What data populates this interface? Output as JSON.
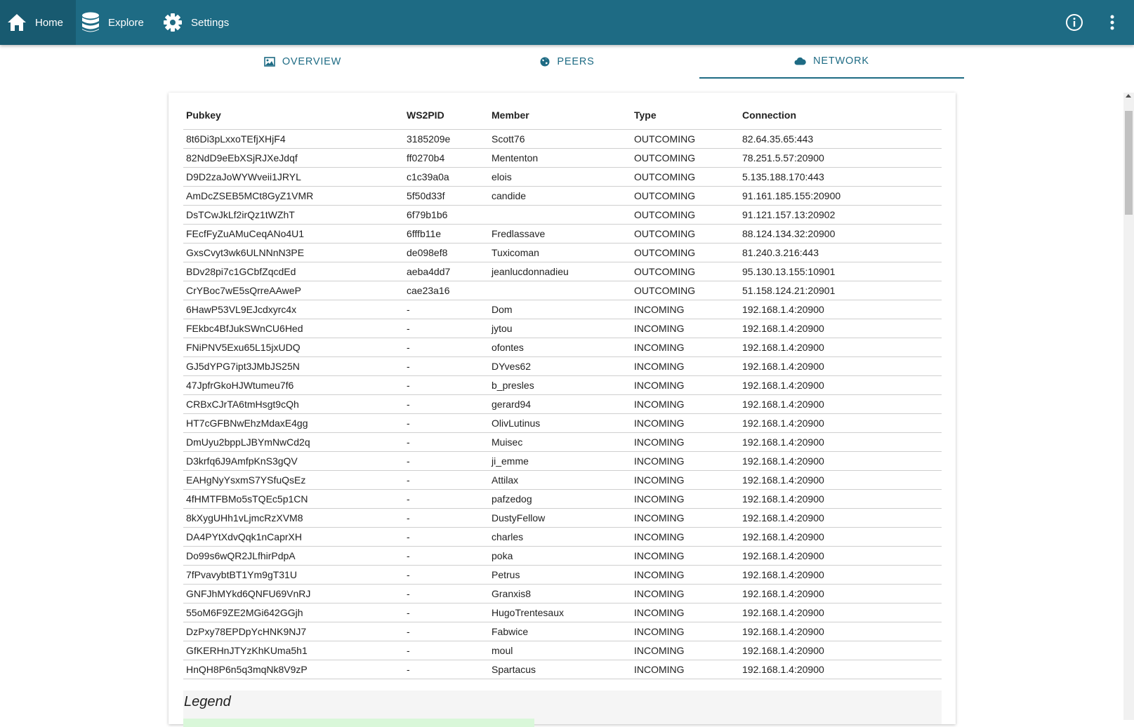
{
  "header": {
    "nav": [
      {
        "label": "Home",
        "icon": "home-icon"
      },
      {
        "label": "Explore",
        "icon": "database-icon"
      },
      {
        "label": "Settings",
        "icon": "gear-icon"
      }
    ],
    "right_icons": [
      "info-icon",
      "more-vert-icon"
    ],
    "color": "#1e6b84"
  },
  "tabs": [
    {
      "label": "OVERVIEW",
      "icon": "image-icon"
    },
    {
      "label": "PEERS",
      "icon": "globe-icon"
    },
    {
      "label": "NETWORK",
      "icon": "cloud-icon",
      "active": true
    }
  ],
  "table": {
    "columns": [
      "Pubkey",
      "WS2PID",
      "Member",
      "Type",
      "Connection"
    ],
    "rows": [
      [
        "8t6Di3pLxxoTEfjXHjF4",
        "3185209e",
        "Scott76",
        "OUTCOMING",
        "82.64.35.65:443"
      ],
      [
        "82NdD9eEbXSjRJXeJdqf",
        "ff0270b4",
        "Mententon",
        "OUTCOMING",
        "78.251.5.57:20900"
      ],
      [
        "D9D2zaJoWYWveii1JRYL",
        "c1c39a0a",
        "elois",
        "OUTCOMING",
        "5.135.188.170:443"
      ],
      [
        "AmDcZSEB5MCt8GyZ1VMR",
        "5f50d33f",
        "candide",
        "OUTCOMING",
        "91.161.185.155:20900"
      ],
      [
        "DsTCwJkLf2irQz1tWZhT",
        "6f79b1b6",
        "",
        "OUTCOMING",
        "91.121.157.13:20902"
      ],
      [
        "FEcfFyZuAMuCeqANo4U1",
        "6fffb11e",
        "Fredlassave",
        "OUTCOMING",
        "88.124.134.32:20900"
      ],
      [
        "GxsCvyt3wk6ULNNnN3PE",
        "de098ef8",
        "Tuxicoman",
        "OUTCOMING",
        "81.240.3.216:443"
      ],
      [
        "BDv28pi7c1GCbfZqcdEd",
        "aeba4dd7",
        "jeanlucdonnadieu",
        "OUTCOMING",
        "95.130.13.155:10901"
      ],
      [
        "CrYBoc7wE5sQrreAAweP",
        "cae23a16",
        "",
        "OUTCOMING",
        "51.158.124.21:20901"
      ],
      [
        "6HawP53VL9EJcdxyrc4x",
        "-",
        "Dom",
        "INCOMING",
        "192.168.1.4:20900"
      ],
      [
        "FEkbc4BfJukSWnCU6Hed",
        "-",
        "jytou",
        "INCOMING",
        "192.168.1.4:20900"
      ],
      [
        "FNiPNV5Exu65L15jxUDQ",
        "-",
        "ofontes",
        "INCOMING",
        "192.168.1.4:20900"
      ],
      [
        "GJ5dYPG7ipt3JMbJS25N",
        "-",
        "DYves62",
        "INCOMING",
        "192.168.1.4:20900"
      ],
      [
        "47JpfrGkoHJWtumeu7f6",
        "-",
        "b_presles",
        "INCOMING",
        "192.168.1.4:20900"
      ],
      [
        "CRBxCJrTA6tmHsgt9cQh",
        "-",
        "gerard94",
        "INCOMING",
        "192.168.1.4:20900"
      ],
      [
        "HT7cGFBNwEhzMdaxE4gg",
        "-",
        "OlivLutinus",
        "INCOMING",
        "192.168.1.4:20900"
      ],
      [
        "DmUyu2bppLJBYmNwCd2q",
        "-",
        "Muisec",
        "INCOMING",
        "192.168.1.4:20900"
      ],
      [
        "D3krfq6J9AmfpKnS3gQV",
        "-",
        "ji_emme",
        "INCOMING",
        "192.168.1.4:20900"
      ],
      [
        "EAHgNyYsxmS7YSfuQsEz",
        "-",
        "Attilax",
        "INCOMING",
        "192.168.1.4:20900"
      ],
      [
        "4fHMTFBMo5sTQEc5p1CN",
        "-",
        "pafzedog",
        "INCOMING",
        "192.168.1.4:20900"
      ],
      [
        "8kXygUHh1vLjmcRzXVM8",
        "-",
        "DustyFellow",
        "INCOMING",
        "192.168.1.4:20900"
      ],
      [
        "DA4PYtXdvQqk1nCaprXH",
        "-",
        "charles",
        "INCOMING",
        "192.168.1.4:20900"
      ],
      [
        "Do99s6wQR2JLfhirPdpA",
        "-",
        "poka",
        "INCOMING",
        "192.168.1.4:20900"
      ],
      [
        "7fPvavybtBT1Ym9gT31U",
        "-",
        "Petrus",
        "INCOMING",
        "192.168.1.4:20900"
      ],
      [
        "GNFJhMYkd6QNFU69VnRJ",
        "-",
        "Granxis8",
        "INCOMING",
        "192.168.1.4:20900"
      ],
      [
        "55oM6F9ZE2MGi642GGjh",
        "-",
        "HugoTrentesaux",
        "INCOMING",
        "192.168.1.4:20900"
      ],
      [
        "DzPxy78EPDpYcHNK9NJ7",
        "-",
        "Fabwice",
        "INCOMING",
        "192.168.1.4:20900"
      ],
      [
        "GfKERHnJTYzKhKUma5h1",
        "-",
        "moul",
        "INCOMING",
        "192.168.1.4:20900"
      ],
      [
        "HnQH8P6n5q3mqNk8V9zP",
        "-",
        "Spartacus",
        "INCOMING",
        "192.168.1.4:20900"
      ]
    ]
  },
  "legend": {
    "title": "Legend",
    "highlight_color": "#d9f7d9"
  }
}
